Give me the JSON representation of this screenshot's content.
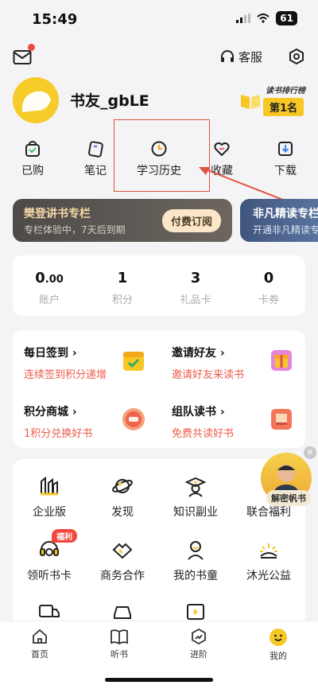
{
  "status_bar": {
    "time": "15:49",
    "battery": "61"
  },
  "header": {
    "service_label": "客服"
  },
  "profile": {
    "username": "书友_gbLE",
    "rank_title": "读书排行榜",
    "rank_value": "第1名"
  },
  "quick_actions": [
    {
      "label": "已购",
      "icon": "bag-icon"
    },
    {
      "label": "笔记",
      "icon": "note-icon"
    },
    {
      "label": "学习历史",
      "icon": "clock-icon"
    },
    {
      "label": "收藏",
      "icon": "heart-icon"
    },
    {
      "label": "下载",
      "icon": "download-icon"
    }
  ],
  "vip_cards": [
    {
      "title": "樊登讲书专栏",
      "subtitle": "专栏体验中，7天后到期",
      "button": "付费订阅"
    },
    {
      "title": "非凡精读专栏",
      "subtitle": "开通非凡精读专栏"
    }
  ],
  "stats": [
    {
      "value": "0",
      "decimal": ".00",
      "label": "账户"
    },
    {
      "value": "1",
      "decimal": "",
      "label": "积分"
    },
    {
      "value": "3",
      "decimal": "",
      "label": "礼品卡"
    },
    {
      "value": "0",
      "decimal": "",
      "label": "卡券"
    }
  ],
  "tasks": [
    {
      "title": "每日签到",
      "subtitle": "连续签到积分递增"
    },
    {
      "title": "邀请好友",
      "subtitle": "邀请好友来读书"
    },
    {
      "title": "积分商城",
      "subtitle": "1积分兑换好书"
    },
    {
      "title": "组队读书",
      "subtitle": "免费共读好书"
    }
  ],
  "services": [
    {
      "label": "企业版"
    },
    {
      "label": "发现"
    },
    {
      "label": "知识副业"
    },
    {
      "label": "联合福利"
    },
    {
      "label": "领听书卡"
    },
    {
      "label": "商务合作"
    },
    {
      "label": "我的书童"
    },
    {
      "label": "沐光公益"
    }
  ],
  "welfare_tag": "福利",
  "float_widget": {
    "label": "解密帆书"
  },
  "tabbar": [
    {
      "label": "首页"
    },
    {
      "label": "听书"
    },
    {
      "label": "进阶"
    },
    {
      "label": "我的"
    }
  ],
  "colors": {
    "accent": "#f7c726",
    "highlight": "#e2503e",
    "task_red": "#ee5b4c"
  }
}
